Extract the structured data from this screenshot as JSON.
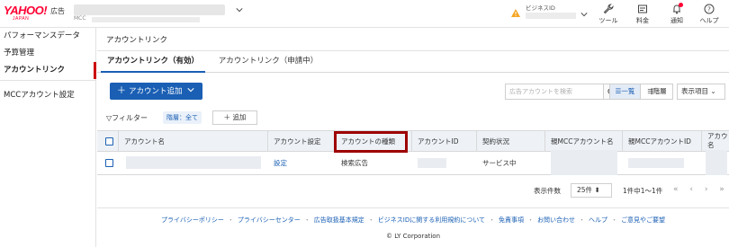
{
  "header": {
    "logo_text": "YAHOO!",
    "logo_sub": "JAPAN",
    "ads_label": "広告",
    "account_mcc_label": "MCC",
    "bizid_label": "ビジネスID",
    "tools_label": "ツール",
    "fees_label": "料金",
    "notifications_label": "通知",
    "help_label": "ヘルプ"
  },
  "sidebar": {
    "items": [
      {
        "label": "パフォーマンスデータ"
      },
      {
        "label": "予算管理"
      },
      {
        "label": "アカウントリンク"
      },
      {
        "label": "MCCアカウント設定"
      }
    ]
  },
  "main": {
    "title": "アカウントリンク",
    "tabs": [
      {
        "label": "アカウントリンク（有効）"
      },
      {
        "label": "アカウントリンク（申請中）"
      }
    ],
    "add_button_label": "アカウント追加",
    "search_placeholder": "広告アカウントを検索",
    "view_list_label": "一覧",
    "view_tree_label": "階層",
    "display_items_label": "表示項目",
    "filter_label": "フィルター",
    "filter_chip": "階層：全て",
    "filter_add_label": "追加"
  },
  "table": {
    "columns": [
      "アカウント名",
      "アカウント設定",
      "アカウントの種類",
      "アカウントID",
      "契約状況",
      "親MCCアカウント名",
      "親MCCアカウントID",
      "アカウ名"
    ],
    "rows": [
      {
        "settings": "設定",
        "type": "検索広告",
        "status": "サービス中"
      }
    ]
  },
  "pager": {
    "label": "表示件数",
    "page_size": "25件",
    "range": "1件中1〜1件",
    "nav": "« ‹ › »"
  },
  "footer": {
    "links": [
      "プライバシーポリシー",
      "プライバシーセンター",
      "広告取扱基本規定",
      "ビジネスIDに関する利用規約について",
      "免責事項",
      "お問い合わせ",
      "ヘルプ",
      "ご意見やご要望"
    ],
    "copyright": "© LY Corporation"
  },
  "colors": {
    "brand_red": "#ff0033",
    "primary_blue": "#1a5fb4",
    "highlight": "#9e0000"
  }
}
